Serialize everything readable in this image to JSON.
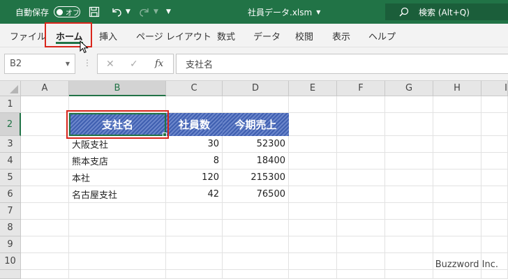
{
  "titlebar": {
    "autosave_label": "自動保存",
    "autosave_state": "オフ",
    "doc_title": "社員データ.xlsm",
    "search_label": "検索 (Alt+Q)"
  },
  "ribbon": {
    "tabs": [
      {
        "label": "ファイル"
      },
      {
        "label": "ホーム",
        "active": true
      },
      {
        "label": "挿入"
      },
      {
        "label": "ページ レイアウト"
      },
      {
        "label": "数式"
      },
      {
        "label": "データ"
      },
      {
        "label": "校閲"
      },
      {
        "label": "表示"
      },
      {
        "label": "ヘルプ"
      }
    ]
  },
  "formula_bar": {
    "name_box": "B2",
    "fx_label": "fx",
    "content": "支社名"
  },
  "sheet": {
    "columns": [
      "A",
      "B",
      "C",
      "D",
      "E",
      "F",
      "G",
      "H",
      "I"
    ],
    "rows": [
      "1",
      "2",
      "3",
      "4",
      "5",
      "6",
      "7",
      "8",
      "9",
      "10"
    ],
    "selected_cell": "B2",
    "table": {
      "headers": [
        "支社名",
        "社員数",
        "今期売上"
      ],
      "rows": [
        [
          "大阪支社",
          "30",
          "52300"
        ],
        [
          "熊本支店",
          "8",
          "18400"
        ],
        [
          "本社",
          "120",
          "215300"
        ],
        [
          "名古屋支社",
          "42",
          "76500"
        ]
      ]
    }
  },
  "watermark": "Buzzword Inc.",
  "colors": {
    "accent": "#217346",
    "highlight_border": "#d9261c",
    "header_fill_dark": "#3f5fb0",
    "header_fill_light": "#6b86cb"
  }
}
